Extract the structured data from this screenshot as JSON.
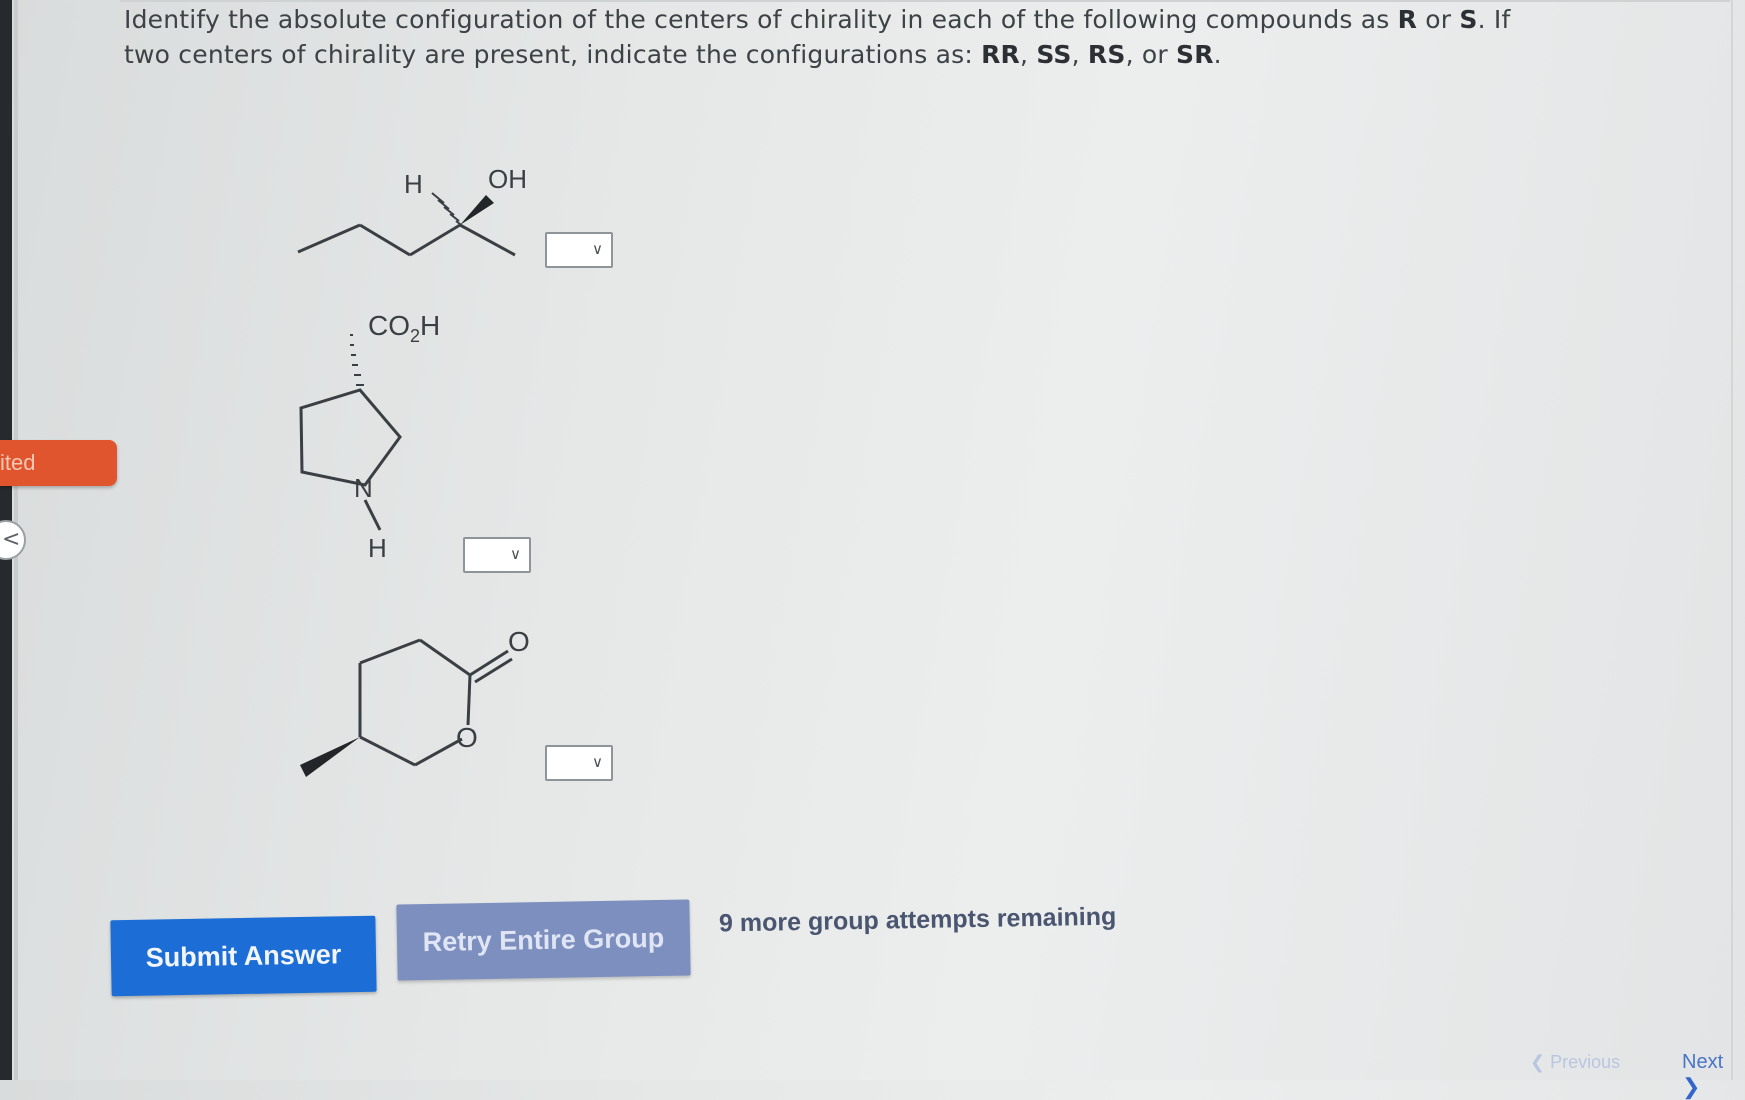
{
  "sidebar": {
    "progress_label": "ited",
    "collapse_icon": "chevron-left-icon"
  },
  "question": {
    "line1_text": "Identify the absolute configuration of the centers of chirality in each of the following compounds as ",
    "line1_R": "R",
    "line1_or": " or ",
    "line1_S": "S",
    "line1_end": ". If",
    "line2_text": "two centers of chirality are present, indicate the configurations as: ",
    "line2_RR": "RR",
    "line2_SS": "SS",
    "line2_RS": "RS",
    "line2_or": "or",
    "line2_SR": "SR",
    "sep_comma": ", ",
    "period": "."
  },
  "compounds": [
    {
      "labels": {
        "h": "H",
        "oh": "OH"
      },
      "selected": ""
    },
    {
      "labels": {
        "co2h_main": "CO",
        "co2h_sub": "2",
        "co2h_h": "H",
        "n": "N",
        "h": "H"
      },
      "selected": ""
    },
    {
      "labels": {
        "o_carbonyl": "O",
        "o_ring": "O"
      },
      "selected": ""
    }
  ],
  "actions": {
    "submit_label": "Submit Answer",
    "retry_label": "Retry Entire Group",
    "attempts_text": "9 more group attempts remaining"
  },
  "navigation": {
    "previous_label": "Previous",
    "next_label": "Next"
  },
  "colors": {
    "submit_bg": "#1c6ed6",
    "retry_bg": "#7d8fbe",
    "progress_tab": "#e0552e"
  }
}
